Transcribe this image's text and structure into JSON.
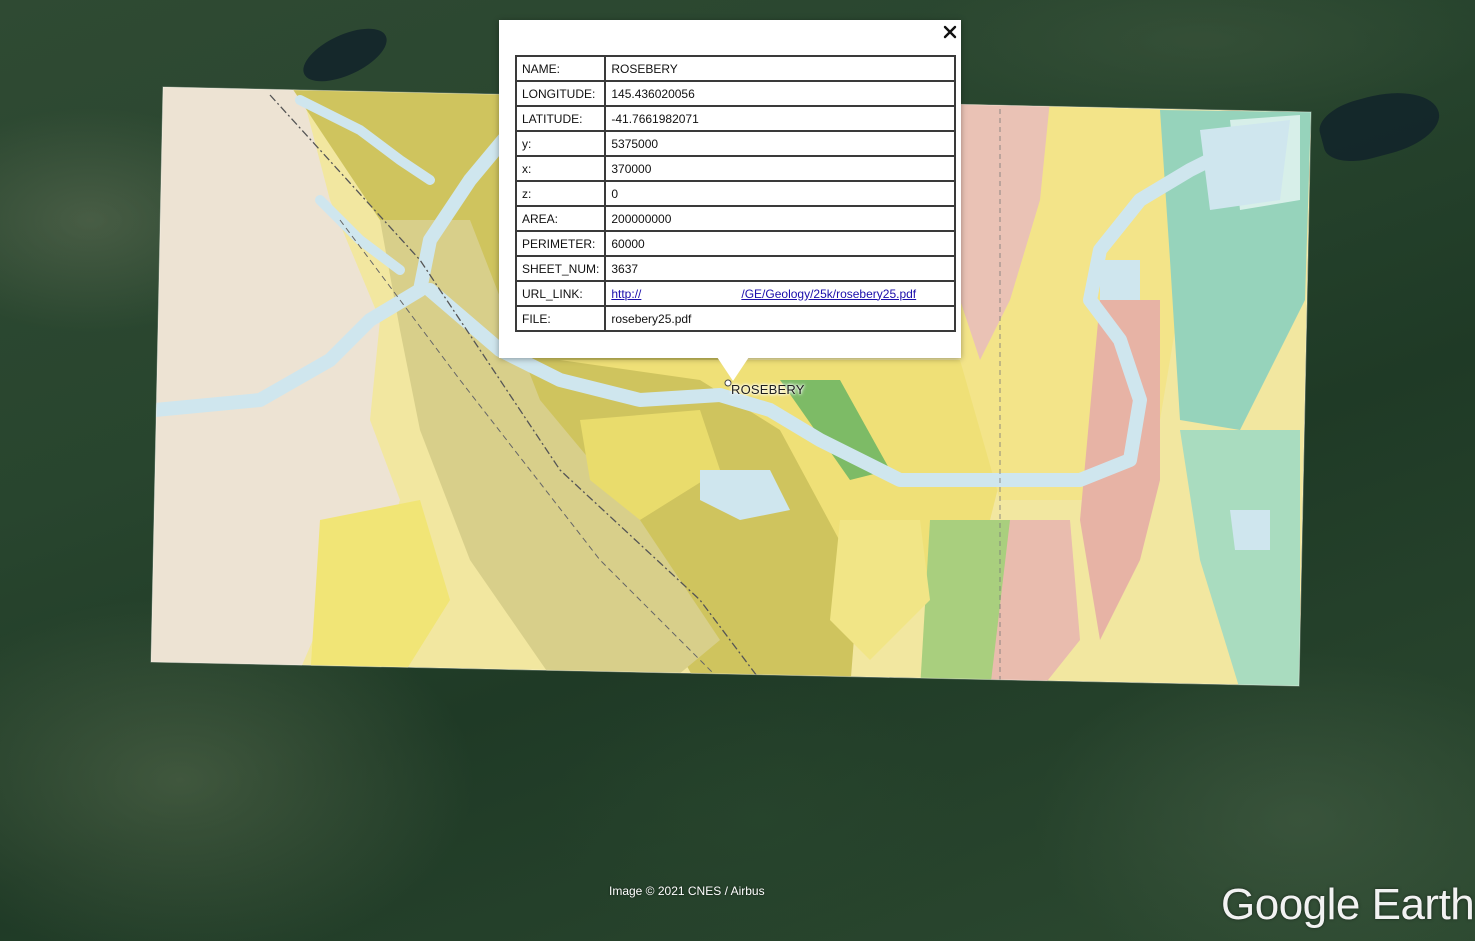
{
  "map": {
    "place_label": "ROSEBERY",
    "attribution": "Image © 2021 CNES / Airbus",
    "logo": "Google Earth",
    "colors": {
      "forest": "#2b4630",
      "water_overlay": "#cfe6ee",
      "geology_yellow": "#f1e57a",
      "geology_olive": "#c9c25a",
      "geology_cream": "#efe6d6",
      "geology_pink": "#e8b9ad",
      "geology_teal": "#8fd1b7"
    }
  },
  "balloon": {
    "close_icon": "close-icon",
    "rows": [
      {
        "key": "NAME:",
        "value": "ROSEBERY"
      },
      {
        "key": "LONGITUDE:",
        "value": "145.436020056"
      },
      {
        "key": "LATITUDE:",
        "value": "-41.7661982071"
      },
      {
        "key": "y:",
        "value": "5375000"
      },
      {
        "key": "x:",
        "value": "370000"
      },
      {
        "key": "z:",
        "value": "0"
      },
      {
        "key": "AREA:",
        "value": "200000000"
      },
      {
        "key": "PERIMETER:",
        "value": "60000"
      },
      {
        "key": "SHEET_NUM:",
        "value": "3637"
      },
      {
        "key": "URL_LINK:",
        "value_start": "http://",
        "value_end": "/GE/Geology/25k/rosebery25.pdf"
      },
      {
        "key": "FILE:",
        "value": "rosebery25.pdf"
      }
    ]
  }
}
